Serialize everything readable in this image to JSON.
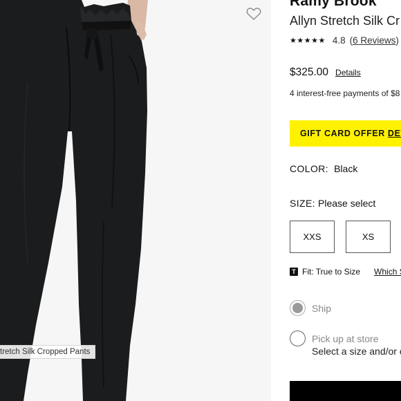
{
  "image": {
    "caption": "tretch Silk Cropped Pants",
    "wishlist_icon": "heart-outline-icon"
  },
  "product": {
    "brand": "Ramy Brook",
    "name": "Allyn Stretch Silk Cr",
    "rating_stars": "★★★★★",
    "rating_value": "4.8",
    "reviews_open": "(",
    "reviews_link": "6 Reviews",
    "reviews_close": ")",
    "price": "$325.00",
    "price_details_link": "Details",
    "installments": "4 interest-free payments of $8"
  },
  "gift_banner": {
    "text": "GIFT CARD OFFER",
    "link": "DETA",
    "color": "#fff200"
  },
  "color_selector": {
    "label": "COLOR:",
    "value": "Black"
  },
  "size_selector": {
    "label": "SIZE:",
    "value": "Please select",
    "options": [
      "XXS",
      "XS"
    ]
  },
  "fit": {
    "badge": "T",
    "text": "Fit: True to Size",
    "link": "Which S"
  },
  "fulfillment": {
    "ship_label": "Ship",
    "ship_selected": true,
    "pickup_label": "Pick up at store",
    "pickup_sub": "Select a size and/or c"
  }
}
